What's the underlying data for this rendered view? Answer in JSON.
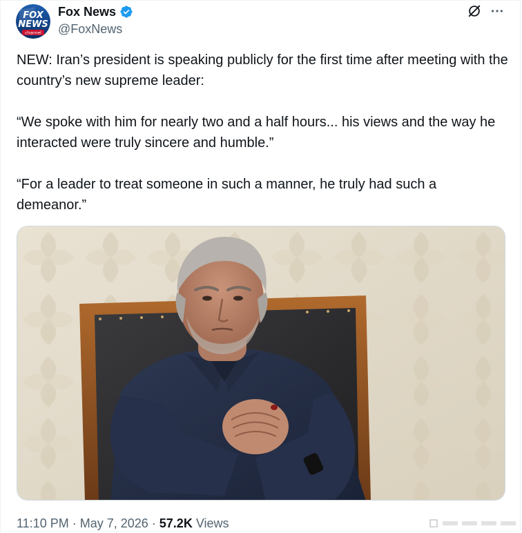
{
  "author": {
    "display_name": "Fox News",
    "handle": "@FoxNews",
    "avatar_icon": "fox-news-logo",
    "avatar_text_line1": "FOX",
    "avatar_text_line2": "NEWS",
    "avatar_text_line3": "channel",
    "verified": true,
    "verified_color": "#1d9bf0"
  },
  "header_icons": {
    "grok": "grok-icon",
    "more": "more-icon"
  },
  "tweet": {
    "paragraphs": [
      "NEW: Iran’s president is speaking publicly for the first time after meeting with the country’s new supreme leader:",
      "“We spoke with him for nearly two and a half hours... his views and the way he interacted were truly sincere and humble.”",
      "“For a leader to treat someone in such a manner, he truly had such a demeanor.”"
    ]
  },
  "media": {
    "kind": "photo"
  },
  "meta": {
    "time": "11:10 PM",
    "separator1": " · ",
    "date": "May 7, 2026",
    "separator2": " · ",
    "views_count": "57.2K",
    "views_label": " Views"
  },
  "colors": {
    "text_primary": "#0f1419",
    "text_secondary": "#536471",
    "fox_blue": "#0a3a78",
    "fox_red": "#c8102e"
  }
}
